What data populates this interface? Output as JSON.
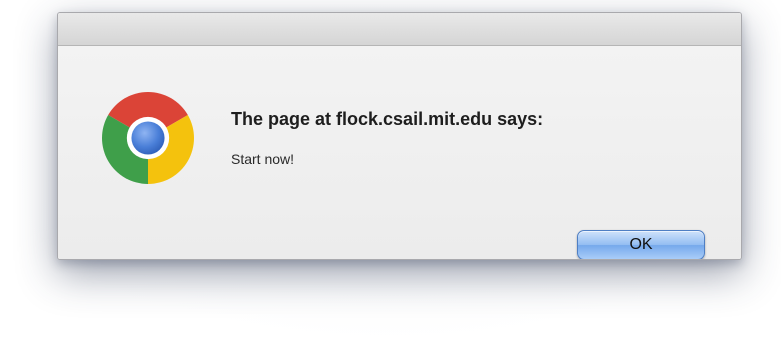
{
  "dialog": {
    "title": "The page at flock.csail.mit.edu says:",
    "message": "Start now!",
    "ok_label": "OK",
    "icon": "chrome-logo-icon"
  },
  "colors": {
    "ok_button": "#8fb9f0",
    "chrome_red": "#db4437",
    "chrome_yellow": "#f4c20d",
    "chrome_green": "#3f9f4a",
    "chrome_blue": "#4a7fd8"
  }
}
